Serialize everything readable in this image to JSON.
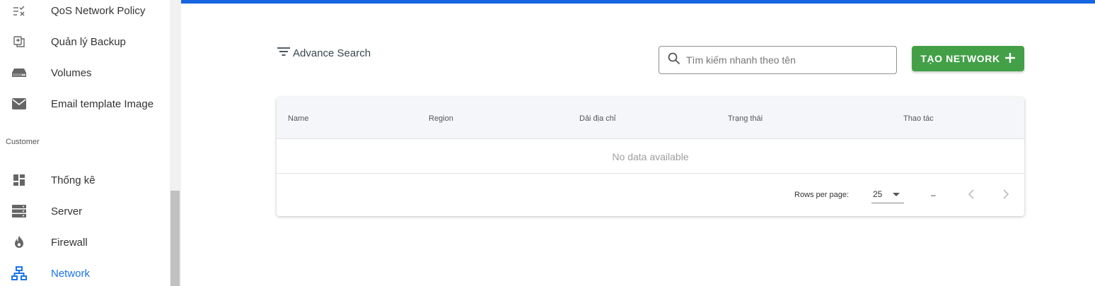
{
  "sidebar": {
    "items_top": [
      {
        "label": "QoS Network Policy",
        "icon": "list-check-icon"
      },
      {
        "label": "Quản lý Backup",
        "icon": "backup-icon"
      },
      {
        "label": "Volumes",
        "icon": "storage-drive-icon"
      },
      {
        "label": "Email template Image",
        "icon": "mail-icon"
      }
    ],
    "section_label": "Customer",
    "items_customer": [
      {
        "label": "Thống kê",
        "icon": "dashboard-icon"
      },
      {
        "label": "Server",
        "icon": "server-icon"
      },
      {
        "label": "Firewall",
        "icon": "fire-icon"
      },
      {
        "label": "Network",
        "icon": "network-icon",
        "active": true
      }
    ]
  },
  "toolbar": {
    "advance_search_label": "Advance Search",
    "search_placeholder": "Tìm kiếm nhanh theo tên",
    "search_value": "",
    "create_button_label": "TẠO NETWORK"
  },
  "table": {
    "columns": [
      "Name",
      "Region",
      "Dải địa chỉ",
      "Trạng thái",
      "Thao tác"
    ],
    "rows": [],
    "empty_text": "No data available",
    "footer": {
      "rows_per_page_label": "Rows per page:",
      "rows_per_page_value": "25",
      "range_text": "–"
    }
  },
  "colors": {
    "accent": "#1565e0",
    "active_nav": "#1a73e8",
    "create_button": "#43a047"
  }
}
